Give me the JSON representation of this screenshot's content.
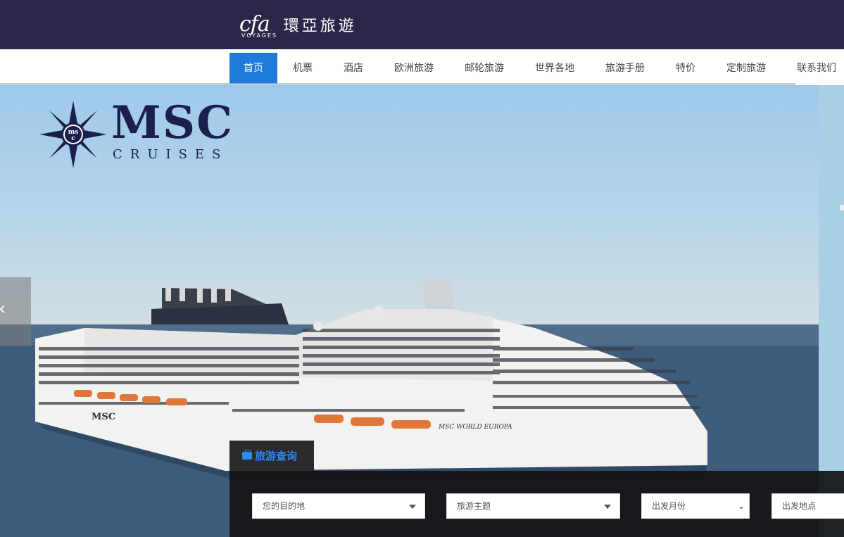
{
  "header": {
    "logo_mark": "cfa",
    "logo_sub": "VOYAGES",
    "brand_name": "環亞旅遊",
    "background": "#2e2649"
  },
  "nav": {
    "items": [
      {
        "label": "首页",
        "active": true
      },
      {
        "label": "机票"
      },
      {
        "label": "酒店"
      },
      {
        "label": "欧洲旅游"
      },
      {
        "label": "邮轮旅游"
      },
      {
        "label": "世界各地"
      },
      {
        "label": "旅游手册"
      },
      {
        "label": "特价"
      },
      {
        "label": "定制旅游"
      },
      {
        "label": "联系我们"
      }
    ],
    "active_color": "#1e7bdc"
  },
  "hero": {
    "brand_big": "MSC",
    "brand_small": "CRUISES",
    "ship_hull_text": "MSC",
    "ship_name_text": "MSC WORLD EUROPA",
    "prev_icon": "chevron-left-icon"
  },
  "search": {
    "tab_label": "旅游查询",
    "tab_icon": "briefcase-icon",
    "fields": {
      "destination": "您的目的地",
      "theme": "旅游主题",
      "month": "出发月份",
      "departure": "出发地点"
    }
  }
}
